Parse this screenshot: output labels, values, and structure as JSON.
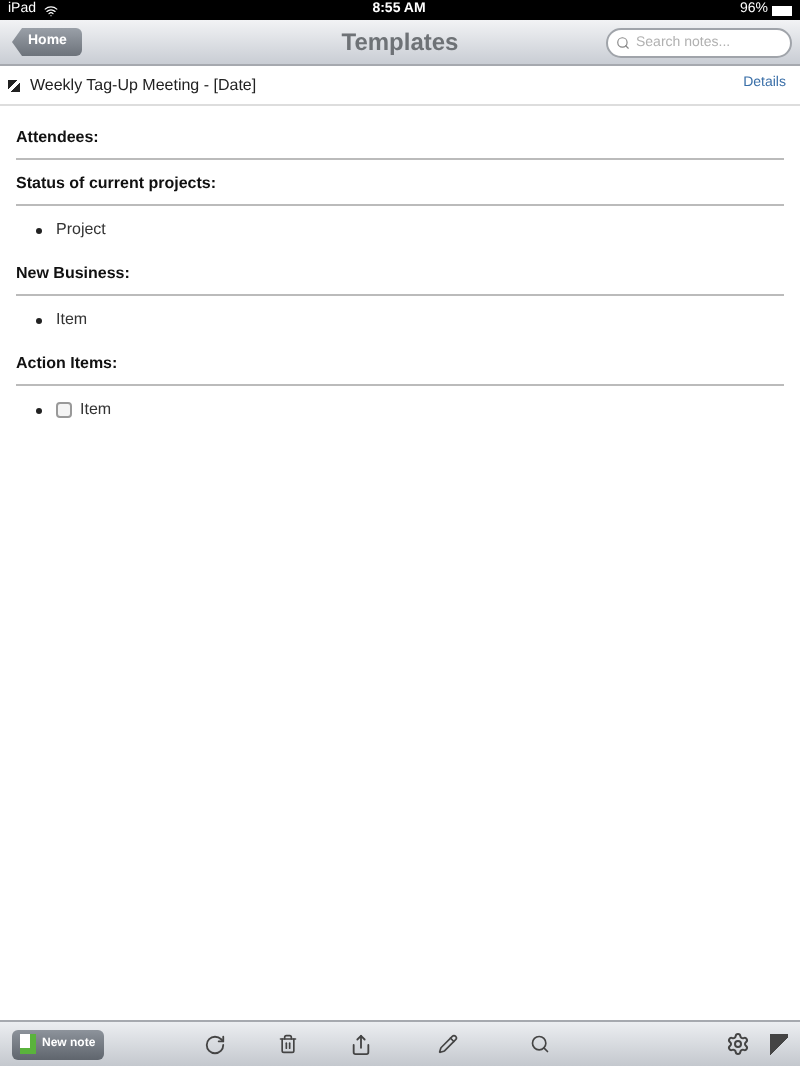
{
  "status_bar": {
    "device": "iPad",
    "time": "8:55 AM",
    "battery": "96%"
  },
  "nav_bar": {
    "back_button": "Home",
    "title": "Templates",
    "search": {
      "placeholder": "Search notes..."
    }
  },
  "note": {
    "title": "Weekly Tag-Up Meeting - [Date]",
    "details_link": "Details"
  },
  "sections": [
    {
      "heading": "Attendees:"
    },
    {
      "heading": "Status of current projects:",
      "items": [
        {
          "kind": "bullet",
          "text": "Project"
        }
      ]
    },
    {
      "heading": "New Business:",
      "items": [
        {
          "kind": "bullet",
          "text": "Item"
        }
      ]
    },
    {
      "heading": "Action Items:",
      "items": [
        {
          "kind": "checkbox",
          "text": "Item",
          "checked": false
        }
      ]
    }
  ],
  "toolbar": {
    "new_note_button": "New note"
  }
}
